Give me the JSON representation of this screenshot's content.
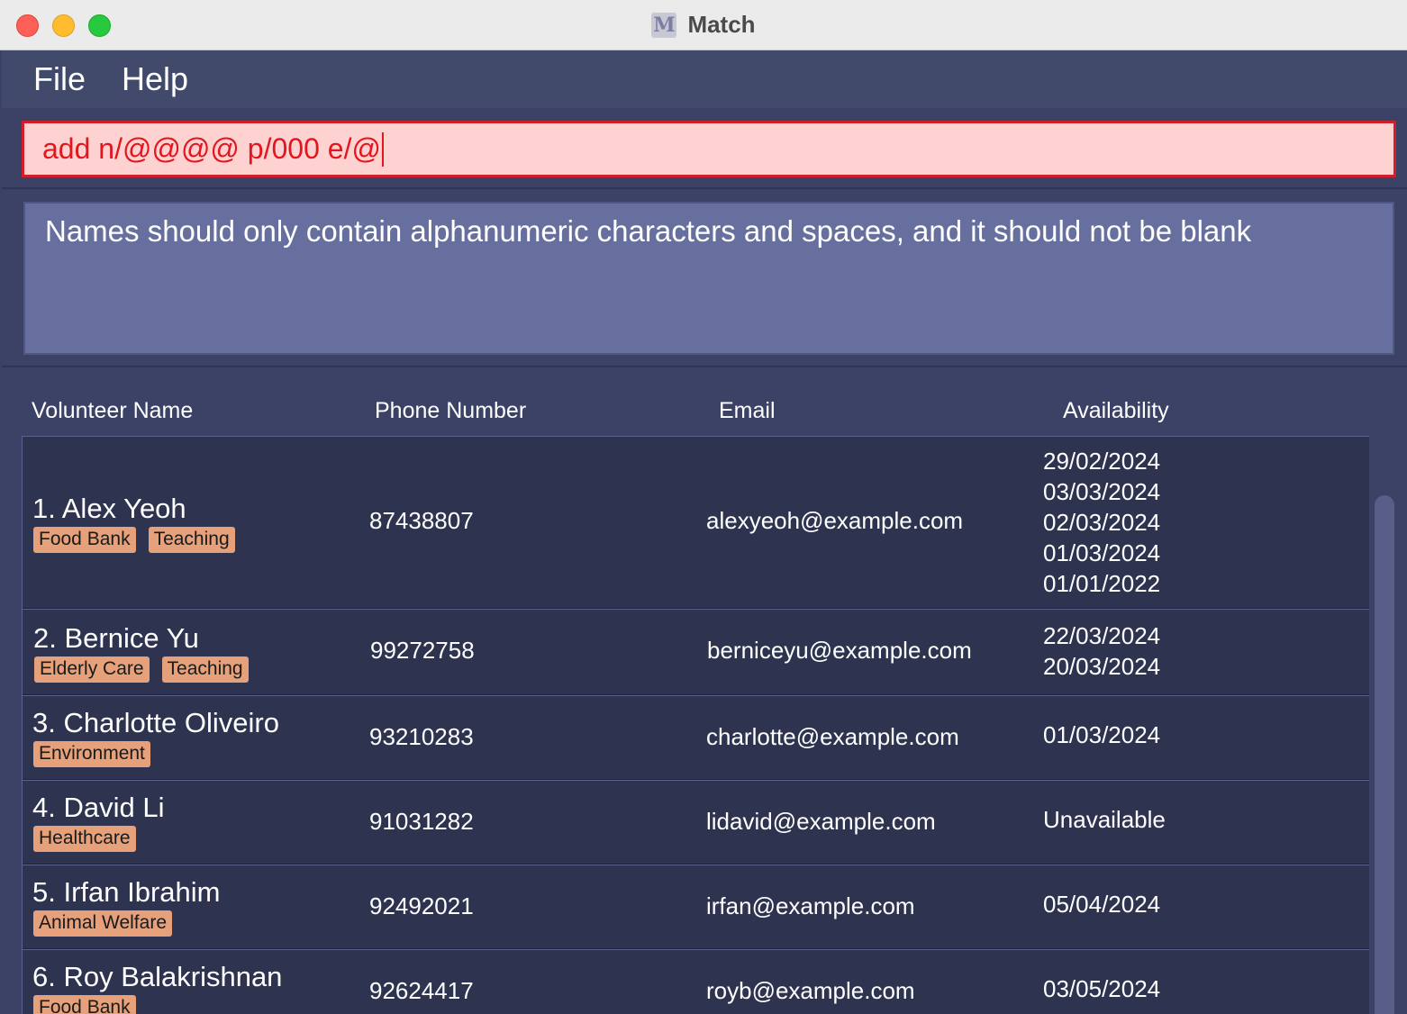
{
  "window": {
    "title": "Match",
    "icon": "app-logo-icon"
  },
  "menu": {
    "file": "File",
    "help": "Help"
  },
  "command": {
    "value": "add n/@@@@ p/000 e/@"
  },
  "result": {
    "message": "Names should only contain alphanumeric characters and spaces, and it should not be blank"
  },
  "columns": {
    "name": "Volunteer Name",
    "phone": "Phone Number",
    "email": "Email",
    "availability": "Availability"
  },
  "volunteers": [
    {
      "name": "1. Alex Yeoh",
      "tags": [
        "Food Bank",
        "Teaching"
      ],
      "phone": "87438807",
      "email": "alexyeoh@example.com",
      "availability": [
        "29/02/2024",
        "03/03/2024",
        "02/03/2024",
        "01/03/2024",
        "01/01/2022"
      ]
    },
    {
      "name": "2. Bernice Yu",
      "tags": [
        "Elderly Care",
        "Teaching"
      ],
      "phone": "99272758",
      "email": "berniceyu@example.com",
      "availability": [
        "22/03/2024",
        "20/03/2024"
      ]
    },
    {
      "name": "3. Charlotte Oliveiro",
      "tags": [
        "Environment"
      ],
      "phone": "93210283",
      "email": "charlotte@example.com",
      "availability": [
        "01/03/2024"
      ]
    },
    {
      "name": "4. David Li",
      "tags": [
        "Healthcare"
      ],
      "phone": "91031282",
      "email": "lidavid@example.com",
      "availability": [
        "Unavailable"
      ]
    },
    {
      "name": "5. Irfan Ibrahim",
      "tags": [
        "Animal Welfare"
      ],
      "phone": "92492021",
      "email": "irfan@example.com",
      "availability": [
        "05/04/2024"
      ]
    },
    {
      "name": "6. Roy Balakrishnan",
      "tags": [
        "Food Bank"
      ],
      "phone": "92624417",
      "email": "royb@example.com",
      "availability": [
        "03/05/2024"
      ]
    }
  ]
}
